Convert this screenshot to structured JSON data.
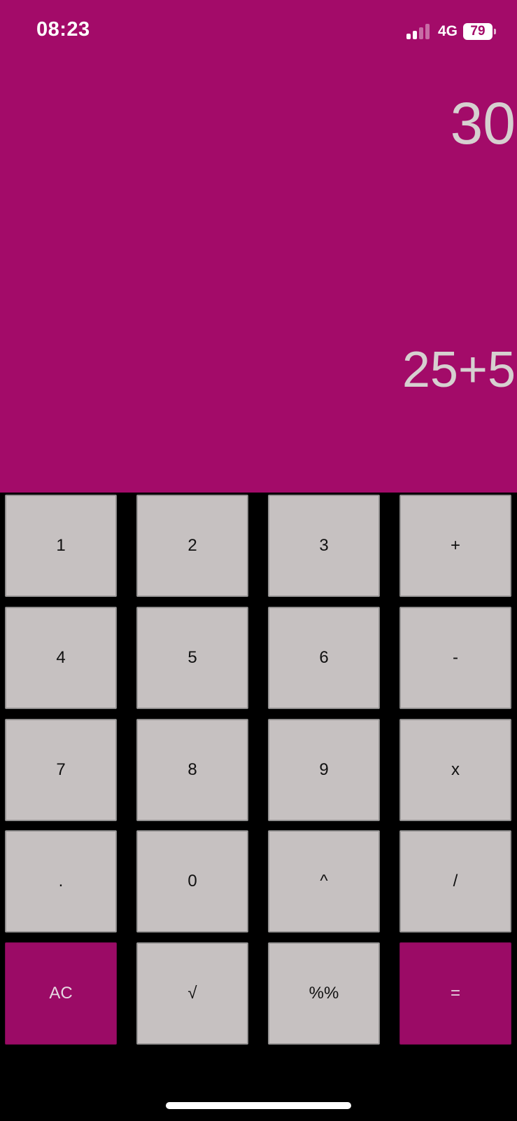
{
  "colors": {
    "display_background": "#a30b69",
    "keypad_background": "#000000",
    "key_background": "#c6c1c1",
    "accent_key_background": "#9b0b66",
    "display_text": "#d6d0d0"
  },
  "status_bar": {
    "time": "08:23",
    "network": "4G",
    "battery": "79",
    "signal_bars_active": 2,
    "signal_bars_total": 4
  },
  "display": {
    "result": "30",
    "expression": "25+5"
  },
  "keypad": {
    "rows": [
      [
        {
          "label": "1",
          "icon": "",
          "accent": false
        },
        {
          "label": "2",
          "icon": "",
          "accent": false
        },
        {
          "label": "3",
          "icon": "",
          "accent": false
        },
        {
          "label": "+",
          "icon": "",
          "accent": false
        }
      ],
      [
        {
          "label": "4",
          "icon": "",
          "accent": false
        },
        {
          "label": "5",
          "icon": "",
          "accent": false
        },
        {
          "label": "6",
          "icon": "",
          "accent": false
        },
        {
          "label": "-",
          "icon": "",
          "accent": false
        }
      ],
      [
        {
          "label": "7",
          "icon": "",
          "accent": false
        },
        {
          "label": "8",
          "icon": "",
          "accent": false
        },
        {
          "label": "9",
          "icon": "",
          "accent": false
        },
        {
          "label": "x",
          "icon": "",
          "accent": false
        }
      ],
      [
        {
          "label": ".",
          "icon": "",
          "accent": false
        },
        {
          "label": "0",
          "icon": "",
          "accent": false
        },
        {
          "label": "^",
          "icon": "",
          "accent": false
        },
        {
          "label": "/",
          "icon": "",
          "accent": false
        }
      ],
      [
        {
          "label": "AC",
          "icon": "",
          "accent": true
        },
        {
          "label": "√",
          "icon": "",
          "accent": false
        },
        {
          "label": "%%",
          "icon": "",
          "accent": false
        },
        {
          "label": "=",
          "icon": "",
          "accent": true
        }
      ]
    ]
  }
}
